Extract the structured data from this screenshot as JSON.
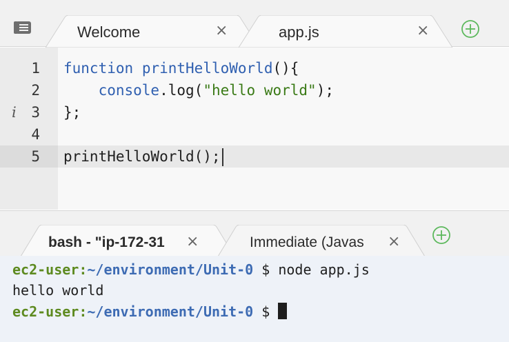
{
  "editor_tabs": [
    {
      "label": "Welcome",
      "close": "×",
      "active": false
    },
    {
      "label": "app.js",
      "close": "×",
      "active": true
    }
  ],
  "code": {
    "lines": [
      {
        "number": "1",
        "info": ""
      },
      {
        "number": "2",
        "info": ""
      },
      {
        "number": "3",
        "info": "i"
      },
      {
        "number": "4",
        "info": ""
      },
      {
        "number": "5",
        "info": ""
      }
    ],
    "tokens": {
      "l1_kw": "function",
      "l1_fn": "printHelloWorld",
      "l1_rest": "(){",
      "l2_indent": "    ",
      "l2_obj": "console",
      "l2_dot": ".log(",
      "l2_str": "\"hello world\"",
      "l2_rest": ");",
      "l3": "};",
      "l5": "printHelloWorld();"
    }
  },
  "terminal_tabs": [
    {
      "label": "bash - \"ip-172-31",
      "close": "×"
    },
    {
      "label": "Immediate (Javas",
      "close": "×"
    }
  ],
  "terminal": {
    "user": "ec2-user",
    "colon": ":",
    "path": "~/environment/Unit-0",
    "prompt_symbol": " $ ",
    "command": "node app.js",
    "output": "hello world"
  },
  "colors": {
    "accent_green": "#5cb85c",
    "keyword_blue": "#2f5fb0",
    "string_green": "#3a7a16"
  },
  "icons": {
    "menu": "list-menu-icon",
    "new_tab": "plus-circle-icon",
    "close": "close-icon",
    "info": "info-icon"
  }
}
